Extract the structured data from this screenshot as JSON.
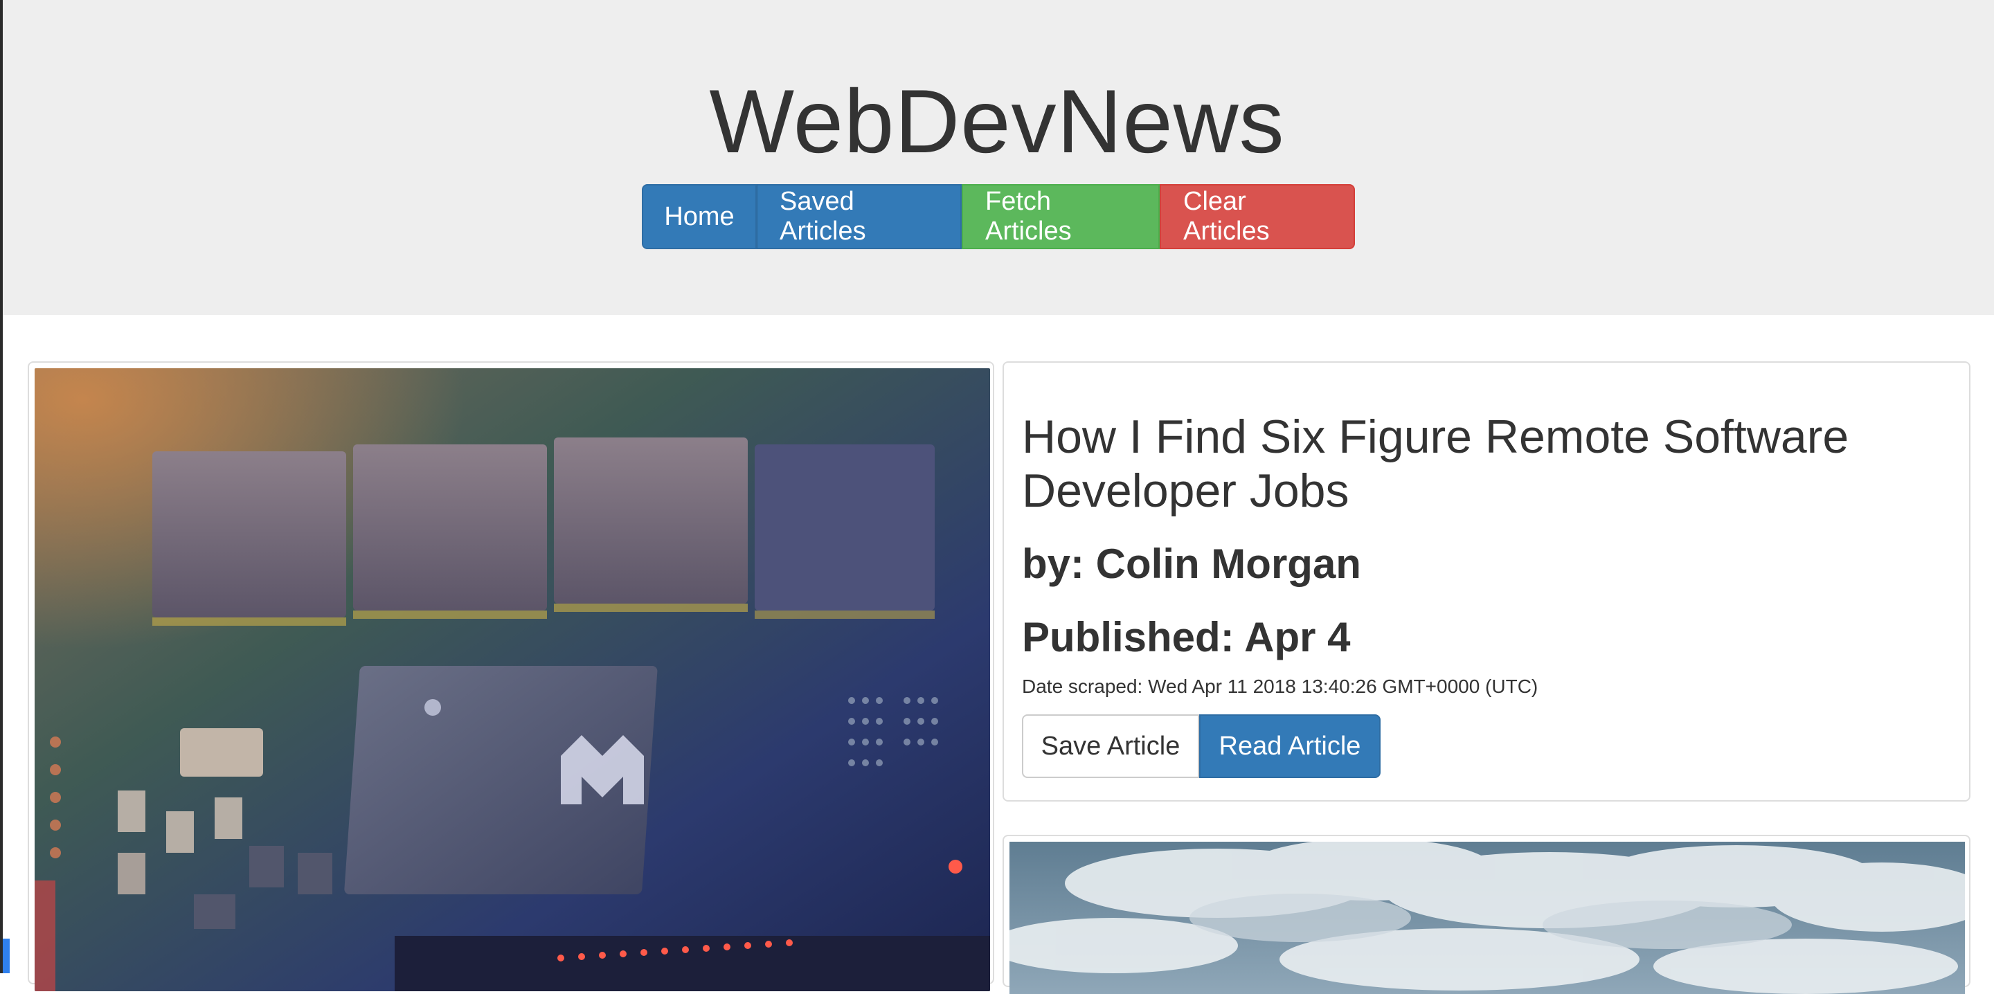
{
  "header": {
    "site_title": "WebDevNews",
    "nav": {
      "home": "Home",
      "saved": "Saved Articles",
      "fetch": "Fetch Articles",
      "clear": "Clear Articles"
    }
  },
  "articles": [
    {
      "title": "How I Find Six Figure Remote Software Developer Jobs",
      "author": "by: Colin Morgan",
      "published": "Published: Apr 4",
      "scraped": "Date scraped: Wed Apr 11 2018 13:40:26 GMT+0000 (UTC)",
      "save_label": "Save Article",
      "read_label": "Read Article",
      "image": "circuit-board-photo"
    },
    {
      "image": "cloudy-sky-photo"
    }
  ],
  "colors": {
    "primary": "#337ab7",
    "success": "#5cb85c",
    "danger": "#d9534f",
    "jumbotron": "#eeeeee"
  }
}
